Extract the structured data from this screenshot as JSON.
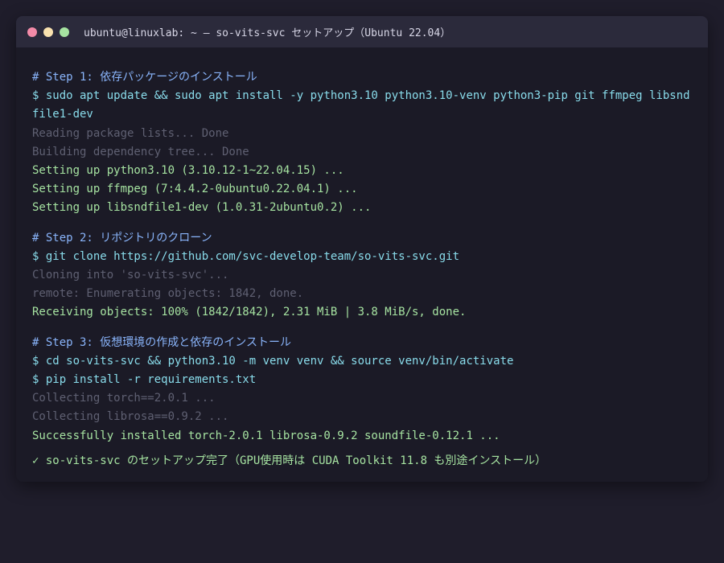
{
  "window": {
    "title": "ubuntu@linuxlab: ~ — so-vits-svc セットアップ（Ubuntu 22.04）",
    "buttons": {
      "close_color": "#f38ba8",
      "minimize_color": "#f9e2af",
      "maximize_color": "#a6e3a1"
    }
  },
  "terminal": {
    "step1": {
      "comment": "# Step 1: 依存パッケージのインストール",
      "command": "$ sudo apt update && sudo apt install -y python3.10 python3.10-venv python3-pip git ffmpeg libsndfile1-dev",
      "out1": "Reading package lists... Done",
      "out2": "Building dependency tree... Done",
      "out3": "Setting up python3.10 (3.10.12-1~22.04.15) ...",
      "out4": "Setting up ffmpeg (7:4.4.2-0ubuntu0.22.04.1) ...",
      "out5": "Setting up libsndfile1-dev (1.0.31-2ubuntu0.2) ..."
    },
    "step2": {
      "comment": "# Step 2: リポジトリのクローン",
      "command": "$ git clone https://github.com/svc-develop-team/so-vits-svc.git",
      "out1": "Cloning into 'so-vits-svc'...",
      "out2": "remote: Enumerating objects: 1842, done.",
      "out3": "Receiving objects: 100% (1842/1842), 2.31 MiB | 3.8 MiB/s, done."
    },
    "step3": {
      "comment": "# Step 3: 仮想環境の作成と依存のインストール",
      "command1": "$ cd so-vits-svc && python3.10 -m venv venv && source venv/bin/activate",
      "command2": "$ pip install -r requirements.txt",
      "out1": "Collecting torch==2.0.1 ...",
      "out2": "Collecting librosa==0.9.2 ...",
      "out3": "Successfully installed torch-2.0.1 librosa-0.9.2 soundfile-0.12.1 ..."
    },
    "final": "✓ so-vits-svc のセットアップ完了（GPU使用時は CUDA Toolkit 11.8 も別途インストール）"
  }
}
